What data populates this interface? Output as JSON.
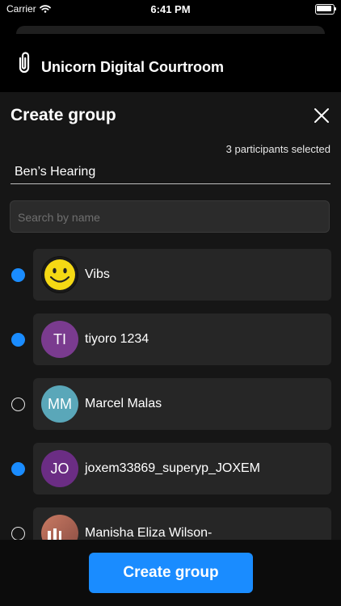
{
  "status_bar": {
    "carrier": "Carrier",
    "time": "6:41 PM"
  },
  "app": {
    "title": "Unicorn Digital Courtroom",
    "logo_icon": "paperclip-icon"
  },
  "sheet": {
    "title": "Create group",
    "close_icon": "close-icon",
    "selected_count": "3 participants selected",
    "group_name": "Ben’s Hearing",
    "search_placeholder": "Search by name"
  },
  "participants": [
    {
      "name": "Vibs",
      "initials": "",
      "avatar": "smiley-icon",
      "selected": true
    },
    {
      "name": "tiyoro 1234",
      "initials": "TI",
      "color": "#7a3b8f",
      "selected": true
    },
    {
      "name": "Marcel Malas",
      "initials": "MM",
      "color": "#5aa7b9",
      "selected": false
    },
    {
      "name": "joxem33869_superyp_JOXEM",
      "initials": "JO",
      "color": "#6b2d84",
      "selected": true
    },
    {
      "name": "Manisha Eliza Wilson-",
      "initials": "",
      "avatar": "photo-avatar",
      "selected": false
    }
  ],
  "create_button": "Create group",
  "colors": {
    "accent": "#1a8cff",
    "card": "#262626",
    "sheet": "#161616"
  }
}
